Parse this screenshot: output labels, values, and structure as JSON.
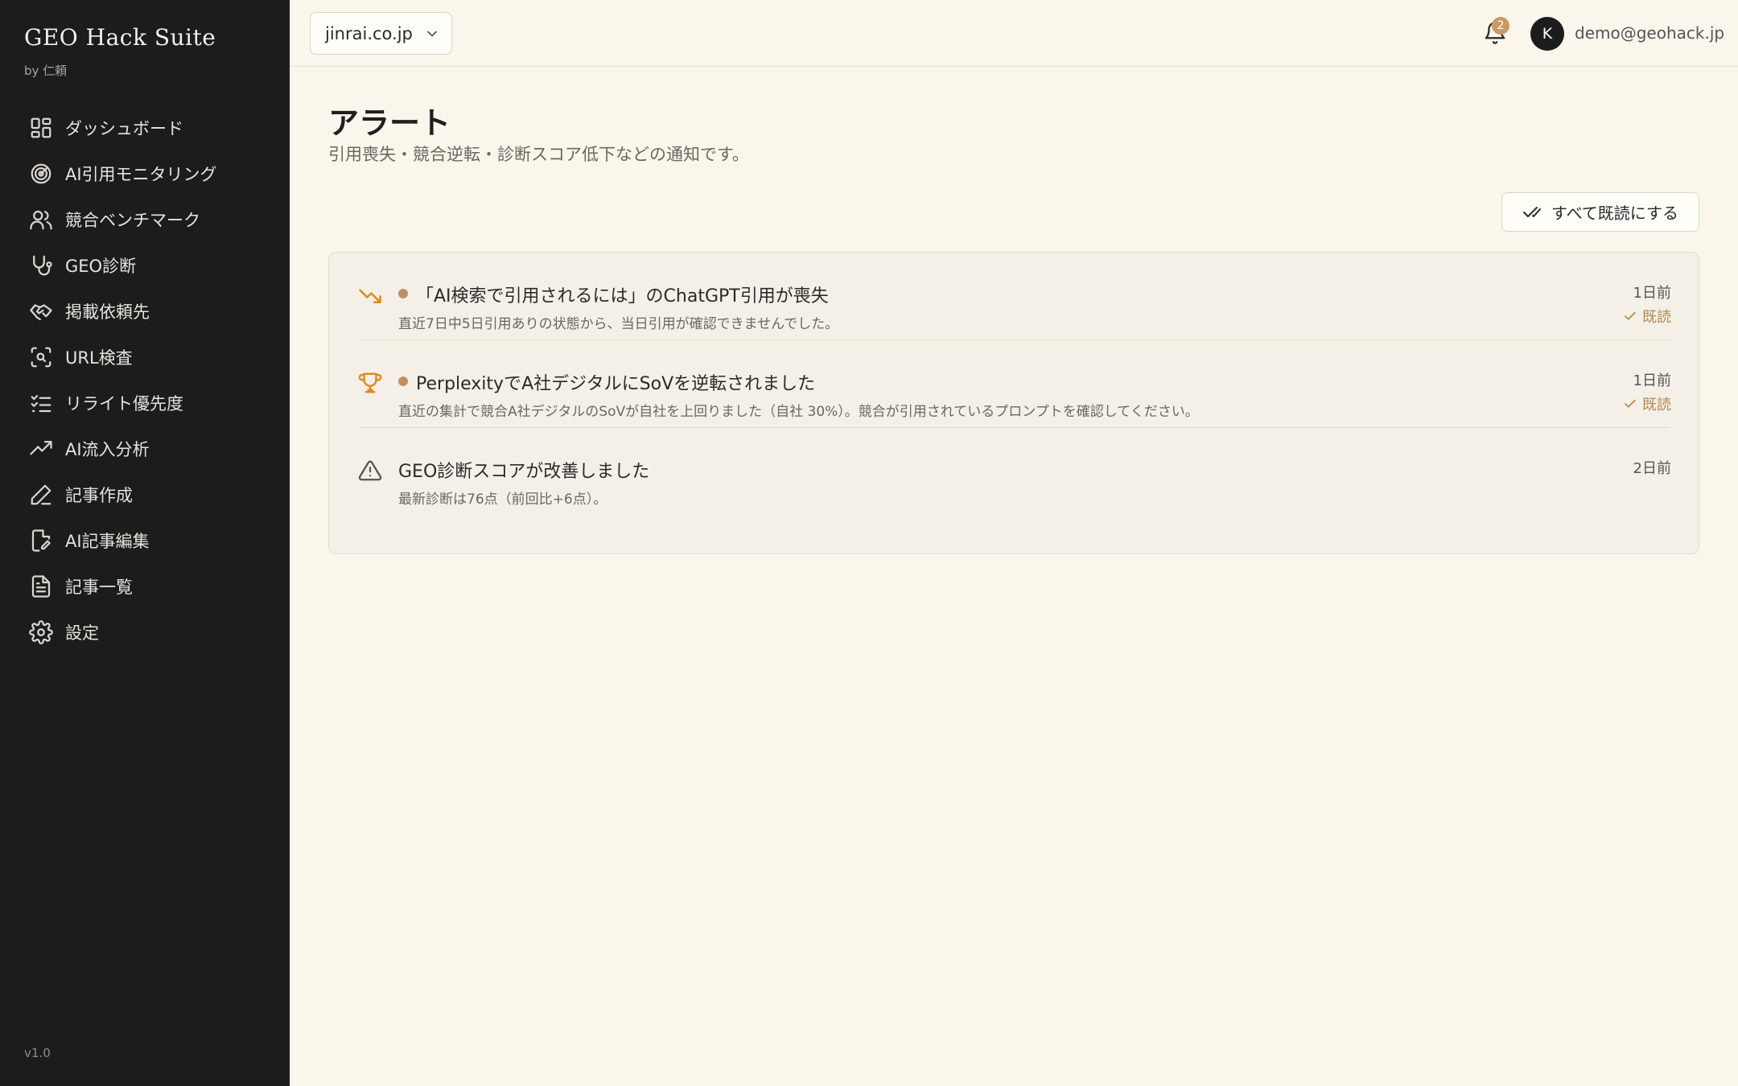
{
  "brand": {
    "title": "GEO Hack Suite",
    "subtitle": "by 仁頼",
    "version": "v1.0"
  },
  "sidebar": {
    "items": [
      {
        "label": "ダッシュボード",
        "icon": "dashboard-grid-icon"
      },
      {
        "label": "AI引用モニタリング",
        "icon": "radar-icon"
      },
      {
        "label": "競合ベンチマーク",
        "icon": "users-icon"
      },
      {
        "label": "GEO診断",
        "icon": "stethoscope-icon"
      },
      {
        "label": "掲載依頼先",
        "icon": "handshake-icon"
      },
      {
        "label": "URL検査",
        "icon": "scan-search-icon"
      },
      {
        "label": "リライト優先度",
        "icon": "list-checks-icon"
      },
      {
        "label": "AI流入分析",
        "icon": "trending-up-icon"
      },
      {
        "label": "記事作成",
        "icon": "pen-icon"
      },
      {
        "label": "AI記事編集",
        "icon": "file-edit-icon"
      },
      {
        "label": "記事一覧",
        "icon": "file-text-icon"
      },
      {
        "label": "設定",
        "icon": "gear-icon"
      }
    ]
  },
  "header": {
    "domain": "jinrai.co.jp",
    "notification_count": "2",
    "avatar_initial": "K",
    "user_email": "demo@geohack.jp"
  },
  "main": {
    "title": "アラート",
    "subtitle": "引用喪失・競合逆転・診断スコア低下などの通知です。",
    "mark_all_label": "すべて既読にする",
    "alerts": [
      {
        "title": "「AI検索で引用されるには」のChatGPT引用が喪失",
        "description": "直近7日中5日引用ありの状態から、当日引用が確認できませんでした。",
        "time": "1日前",
        "read_label": "既読",
        "icon": "trending-down-icon",
        "unread": true
      },
      {
        "title": "PerplexityでA社デジタルにSoVを逆転されました",
        "description": "直近の集計で競合A社デジタルのSoVが自社を上回りました（自社 30%）。競合が引用されているプロンプトを確認してください。",
        "time": "1日前",
        "read_label": "既読",
        "icon": "trophy-icon",
        "unread": true
      },
      {
        "title": "GEO診断スコアが改善しました",
        "description": "最新診断は76点（前回比+6点）。",
        "time": "2日前",
        "icon": "warning-triangle-icon",
        "unread": false
      }
    ]
  },
  "colors": {
    "sidebar_bg": "#1c1c1c",
    "page_bg": "#faf6ec",
    "accent": "#c29060",
    "alert_orange": "#e08a1e"
  }
}
